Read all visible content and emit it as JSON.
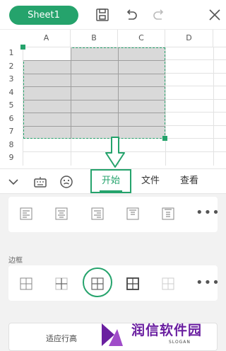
{
  "header": {
    "sheet_tab": "Sheet1",
    "icons": [
      "save-icon",
      "undo-icon",
      "redo-icon",
      "close-icon"
    ]
  },
  "grid": {
    "columns": [
      "A",
      "B",
      "C",
      "D"
    ],
    "rows": [
      "1",
      "2",
      "3",
      "4",
      "5",
      "6",
      "7",
      "8",
      "9"
    ]
  },
  "toolbar": {
    "tabs": [
      "开始",
      "文件",
      "查看"
    ],
    "active_tab": "开始"
  },
  "panel": {
    "more_label": "•••",
    "border_section_label": "边框",
    "fit_row_height_label": "适应行高"
  },
  "watermark": {
    "brand": "润信软件园",
    "slogan": "SLOGAN"
  },
  "colors": {
    "accent": "#25a36c",
    "brand": "#6a1fa0",
    "selection": "#d9d9d9"
  }
}
